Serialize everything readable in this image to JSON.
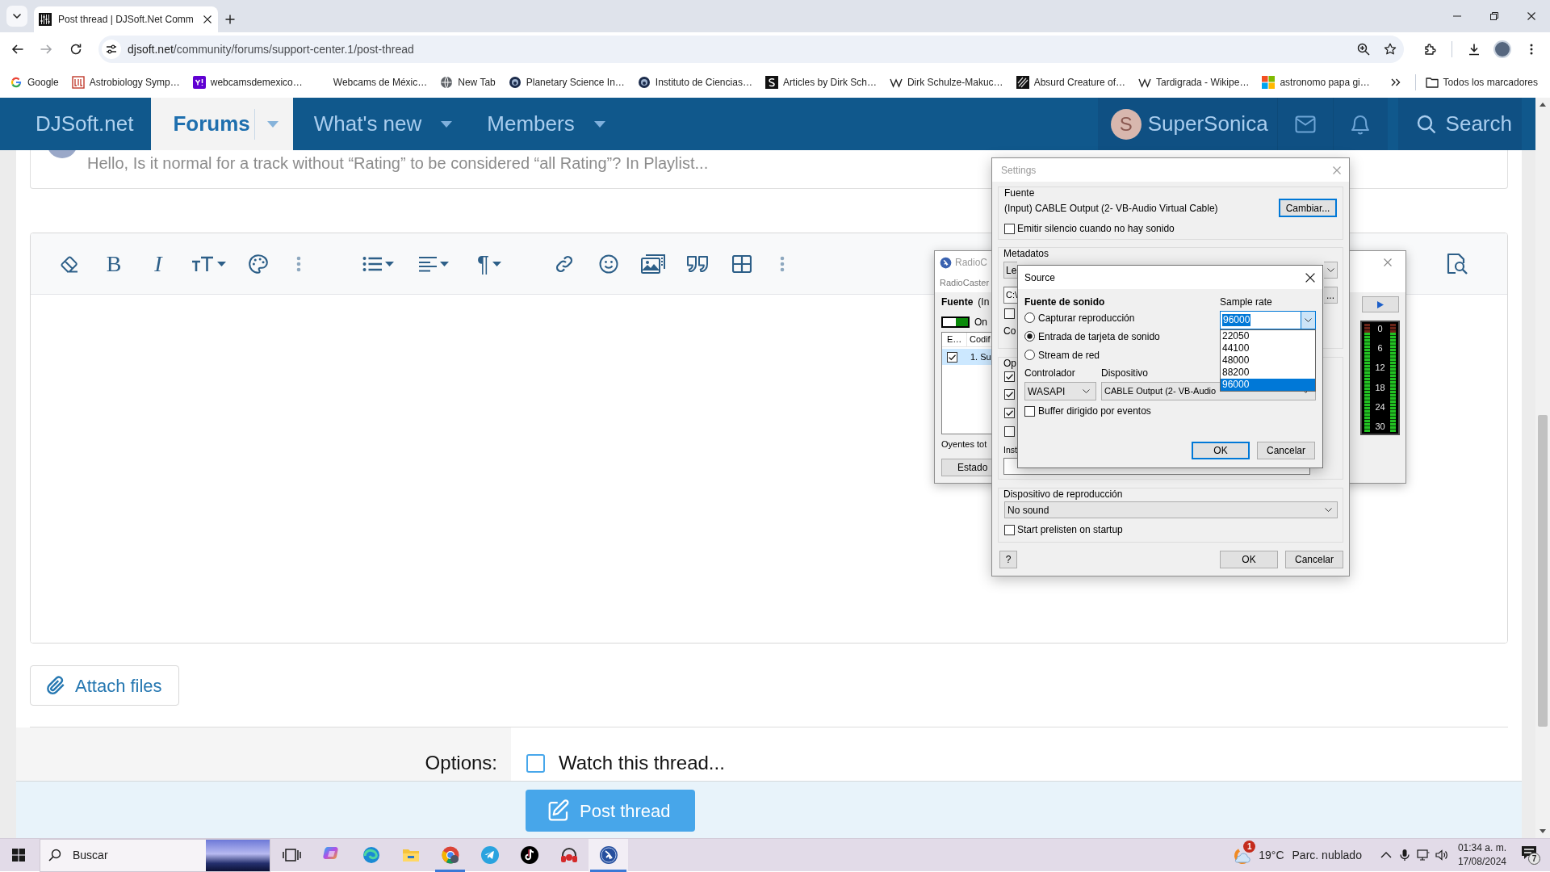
{
  "browser": {
    "tab": {
      "title": "Post thread | DJSoft.Net Comm",
      "selected": true
    },
    "url": {
      "domain": "djsoft.net",
      "path": "/community/forums/support-center.1/post-thread"
    },
    "bookmarks": [
      {
        "label": "Google"
      },
      {
        "label": "Astrobiology Symp…"
      },
      {
        "label": "webcamsdemexico…"
      },
      {
        "label": "Webcams de Méxic…"
      },
      {
        "label": "New Tab"
      },
      {
        "label": "Planetary Science In…"
      },
      {
        "label": "Instituto de Ciencias…"
      },
      {
        "label": "Articles by Dirk Sch…"
      },
      {
        "label": "Dirk Schulze-Makuc…"
      },
      {
        "label": "Absurd Creature of…"
      },
      {
        "label": "Tardigrada - Wikipe…"
      },
      {
        "label": "astronomo papa gi…"
      }
    ],
    "all_bookmarks": "Todos los marcadores"
  },
  "nav": {
    "logo": "DJSoft.net",
    "items": [
      {
        "label": "Forums",
        "selected": true
      },
      {
        "label": "What's new",
        "selected": false
      },
      {
        "label": "Members",
        "selected": false
      }
    ],
    "user": {
      "initial": "S",
      "name": "SuperSonica"
    },
    "search": "Search"
  },
  "thread_preview": {
    "text": "Hello, Is it normal for a track without “Rating” to be considered “all Rating”? In Playlist..."
  },
  "editor": {
    "toolbar_groups": [
      [
        {
          "kind": "eraser",
          "dropdown": false
        },
        {
          "kind": "bold",
          "glyph": "B",
          "dropdown": false
        },
        {
          "kind": "italic",
          "glyph": "I",
          "dropdown": false
        },
        {
          "kind": "text-size",
          "dropdown": true
        },
        {
          "kind": "palette",
          "dropdown": false
        },
        {
          "kind": "more",
          "dropdown": false
        }
      ],
      [
        {
          "kind": "list",
          "dropdown": true
        },
        {
          "kind": "align",
          "dropdown": true
        },
        {
          "kind": "paragraph",
          "glyph": "¶",
          "dropdown": true
        }
      ],
      [
        {
          "kind": "link",
          "dropdown": false
        },
        {
          "kind": "smile",
          "dropdown": false
        },
        {
          "kind": "image",
          "dropdown": false
        },
        {
          "kind": "quote",
          "dropdown": false
        },
        {
          "kind": "table",
          "dropdown": false
        },
        {
          "kind": "more",
          "dropdown": false
        }
      ]
    ]
  },
  "attach": "Attach files",
  "options": {
    "label": "Options:",
    "watch": {
      "label": "Watch this thread...",
      "checked": false
    }
  },
  "submit": "Post thread",
  "radiocaster": {
    "title": "RadioC",
    "subtitle": "RadioCaster",
    "source_label": "Fuente",
    "source_value": "(In",
    "switch": {
      "label": "On",
      "on": true
    },
    "list": {
      "columns": [
        "E…",
        "Codif"
      ],
      "rows": [
        {
          "checked": true,
          "selected": true,
          "label": "1. Su"
        }
      ]
    },
    "listeners": "Oyentes tot",
    "status_button": "Estado",
    "meter": {
      "scale": [
        "0",
        "6",
        "12",
        "18",
        "24",
        "30"
      ],
      "channels": [
        {
          "level": 0.92
        },
        {
          "level": 0.92
        }
      ]
    }
  },
  "settings": {
    "title": "Settings",
    "source_group": {
      "label": "Fuente",
      "value": "(Input) CABLE Output (2- VB-Audio Virtual Cable)",
      "button": "Cambiar...",
      "silence": {
        "label": "Emitir silencio cuando no hay sonido",
        "checked": false
      }
    },
    "metadata_group": {
      "label": "Metadatos",
      "combo_value": "Le",
      "path_value": "C:\\",
      "browse_button": "...",
      "checkbox": {
        "checked": false
      },
      "partial_label": "Co"
    },
    "options_group": {
      "label": "Op",
      "checkboxes": [
        {
          "checked": true
        },
        {
          "checked": true
        },
        {
          "checked": true
        },
        {
          "checked": false
        }
      ],
      "partial_label": "Inst"
    },
    "playback_group": {
      "label": "Dispositivo de reproducción",
      "device": "No sound",
      "prelisten": {
        "label": "Start prelisten on startup",
        "checked": false
      }
    },
    "buttons": {
      "help": "?",
      "ok": "OK",
      "cancel": "Cancelar"
    }
  },
  "source": {
    "title": "Source",
    "heading": "Fuente de sonido",
    "modes": [
      {
        "label": "Capturar reproducción",
        "selected": false
      },
      {
        "label": "Entrada de tarjeta de sonido",
        "selected": true
      },
      {
        "label": "Stream de red",
        "selected": false
      }
    ],
    "sample_rate": {
      "label": "Sample rate",
      "value": "96000",
      "options": [
        {
          "label": "22050",
          "selected": false
        },
        {
          "label": "44100",
          "selected": false
        },
        {
          "label": "48000",
          "selected": false
        },
        {
          "label": "88200",
          "selected": false
        },
        {
          "label": "96000",
          "selected": true
        }
      ]
    },
    "driver": {
      "label": "Controlador",
      "value": "WASAPI"
    },
    "device": {
      "label": "Dispositivo",
      "value": "CABLE Output (2- VB-Audio"
    },
    "event_buffer": {
      "label": "Buffer dirigido por eventos",
      "checked": false
    },
    "ok": "OK",
    "cancel": "Cancelar"
  },
  "taskbar": {
    "search": {
      "placeholder": "Buscar"
    },
    "apps": [
      {
        "kind": "task-view",
        "running": false,
        "active": false
      },
      {
        "kind": "copilot",
        "running": false,
        "active": false
      },
      {
        "kind": "edge",
        "running": false,
        "active": false
      },
      {
        "kind": "explorer",
        "running": false,
        "active": false
      },
      {
        "kind": "chrome",
        "running": true,
        "active": false
      },
      {
        "kind": "telegram",
        "running": false,
        "active": false
      },
      {
        "kind": "tiktok",
        "running": false,
        "active": false
      },
      {
        "kind": "headphones",
        "running": false,
        "active": false
      },
      {
        "kind": "radiocaster",
        "running": true,
        "active": true
      }
    ],
    "weather": {
      "badge": "1",
      "temperature": "19°C",
      "condition": "Parc. nublado"
    },
    "clock": {
      "time": "01:34 a. m.",
      "date": "17/08/2024"
    },
    "notifications": {
      "count": "7"
    }
  }
}
